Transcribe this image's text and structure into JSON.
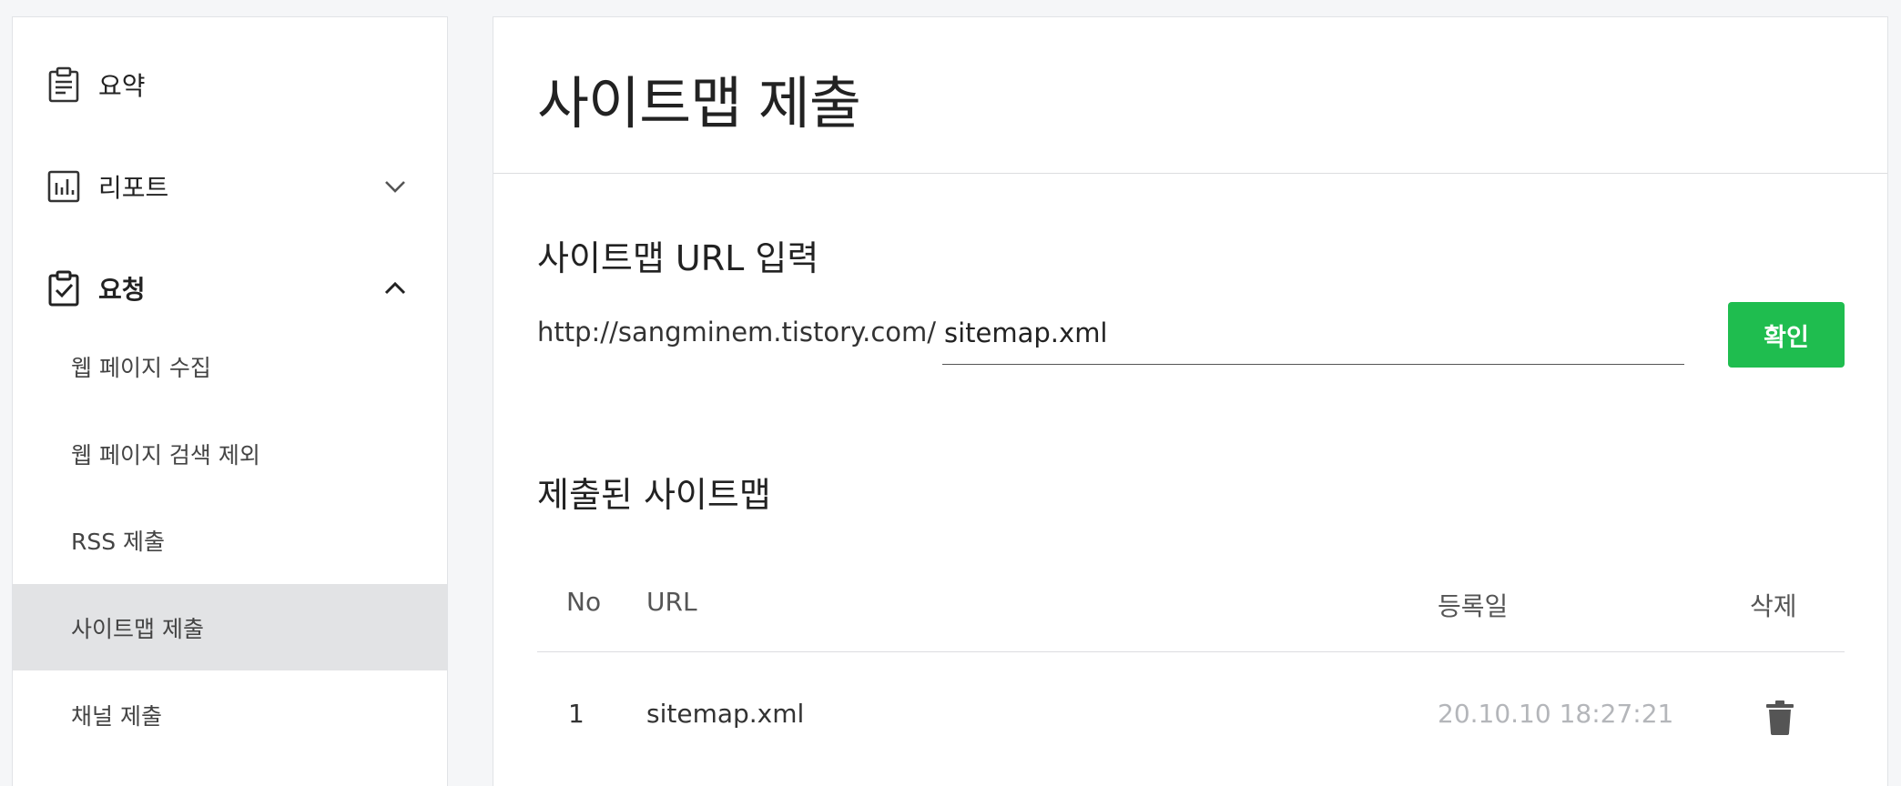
{
  "sidebar": {
    "items": [
      {
        "label": "요약",
        "icon": "clipboard-list-icon"
      },
      {
        "label": "리포트",
        "icon": "bar-chart-icon",
        "chevron": "chevron-down-icon"
      },
      {
        "label": "요청",
        "icon": "clipboard-check-icon",
        "chevron": "chevron-up-icon"
      }
    ],
    "sub_items": [
      {
        "label": "웹 페이지 수집"
      },
      {
        "label": "웹 페이지 검색 제외"
      },
      {
        "label": "RSS 제출"
      },
      {
        "label": "사이트맵 제출",
        "active": true
      },
      {
        "label": "채널 제출"
      }
    ]
  },
  "main": {
    "title": "사이트맵 제출",
    "url_section": {
      "title": "사이트맵 URL 입력",
      "prefix": "http://sangminem.tistory.com/",
      "input_value": "sitemap.xml",
      "confirm_label": "확인"
    },
    "submitted_section": {
      "title": "제출된 사이트맵",
      "columns": {
        "no": "No",
        "url": "URL",
        "date": "등록일",
        "delete": "삭제"
      },
      "rows": [
        {
          "no": "1",
          "url": "sitemap.xml",
          "date": "20.10.10 18:27:21"
        }
      ]
    }
  },
  "colors": {
    "accent_green": "#1fbd4f",
    "active_bg": "#e2e3e5",
    "page_bg": "#f5f6f8"
  }
}
